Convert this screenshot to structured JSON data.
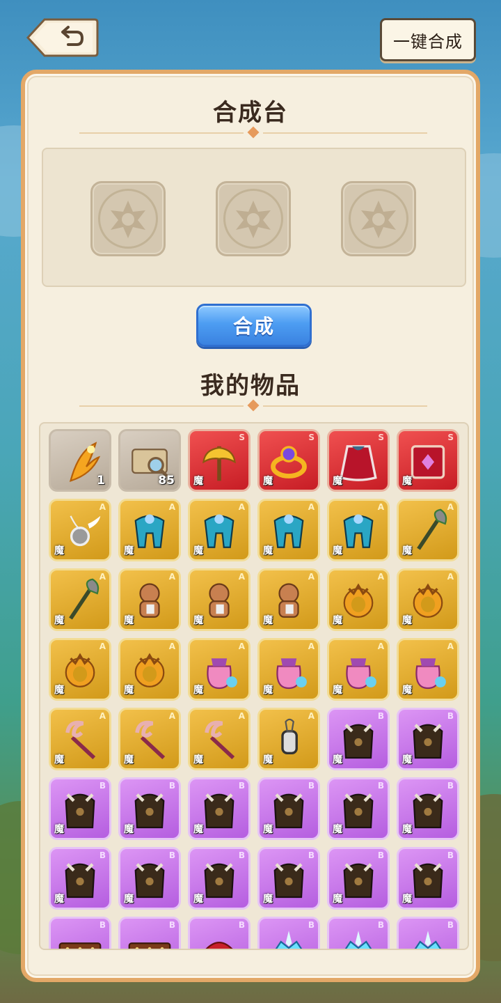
{
  "header": {
    "back_icon": "undo-arrow-icon",
    "one_click_label": "一键合成"
  },
  "synth_table": {
    "title": "合成台",
    "slots": [
      "empty",
      "empty",
      "empty"
    ],
    "slot_icon": "star-badge-icon",
    "button_label": "合成"
  },
  "inventory": {
    "title": "我的物品",
    "tag_label": "魔",
    "rarity_colors": {
      "S": "#d92a2f",
      "A": "#e0aa2a",
      "B": "#c47be8",
      "N": "#c9bcaa"
    },
    "items": [
      {
        "icon": "flame-feather-icon",
        "rarity": "N",
        "count": "1"
      },
      {
        "icon": "magnifier-scroll-icon",
        "rarity": "N",
        "count": "85"
      },
      {
        "icon": "golden-axe-icon",
        "rarity": "S",
        "tag": true
      },
      {
        "icon": "gem-ring-icon",
        "rarity": "S",
        "tag": true
      },
      {
        "icon": "red-cape-icon",
        "rarity": "S",
        "tag": true
      },
      {
        "icon": "red-spellbook-icon",
        "rarity": "S",
        "tag": true
      },
      {
        "icon": "winged-amulet-icon",
        "rarity": "A",
        "tag": true
      },
      {
        "icon": "blue-armor-icon",
        "rarity": "A",
        "tag": true
      },
      {
        "icon": "blue-armor-icon",
        "rarity": "A",
        "tag": true
      },
      {
        "icon": "blue-armor-icon",
        "rarity": "A",
        "tag": true
      },
      {
        "icon": "blue-armor-icon",
        "rarity": "A",
        "tag": true
      },
      {
        "icon": "green-axe-icon",
        "rarity": "A",
        "tag": true
      },
      {
        "icon": "green-axe-icon",
        "rarity": "A",
        "tag": true
      },
      {
        "icon": "voodoo-doll-icon",
        "rarity": "A",
        "tag": true
      },
      {
        "icon": "voodoo-doll-icon",
        "rarity": "A",
        "tag": true
      },
      {
        "icon": "voodoo-doll-icon",
        "rarity": "A",
        "tag": true
      },
      {
        "icon": "dragon-ring-icon",
        "rarity": "A",
        "tag": true
      },
      {
        "icon": "dragon-ring-icon",
        "rarity": "A",
        "tag": true
      },
      {
        "icon": "dragon-ring-icon",
        "rarity": "A",
        "tag": true
      },
      {
        "icon": "dragon-ring-icon",
        "rarity": "A",
        "tag": true
      },
      {
        "icon": "star-pouch-icon",
        "rarity": "A",
        "tag": true
      },
      {
        "icon": "star-pouch-icon",
        "rarity": "A",
        "tag": true
      },
      {
        "icon": "star-pouch-icon",
        "rarity": "A",
        "tag": true
      },
      {
        "icon": "star-pouch-icon",
        "rarity": "A",
        "tag": true
      },
      {
        "icon": "crescent-staff-icon",
        "rarity": "A",
        "tag": true
      },
      {
        "icon": "crescent-staff-icon",
        "rarity": "A",
        "tag": true
      },
      {
        "icon": "crescent-staff-icon",
        "rarity": "A",
        "tag": true
      },
      {
        "icon": "lantern-charm-icon",
        "rarity": "A",
        "tag": true
      },
      {
        "icon": "dark-armor-icon",
        "rarity": "B",
        "tag": true
      },
      {
        "icon": "dark-armor-icon",
        "rarity": "B",
        "tag": true
      },
      {
        "icon": "dark-armor-icon",
        "rarity": "B",
        "tag": true
      },
      {
        "icon": "dark-armor-icon",
        "rarity": "B",
        "tag": true
      },
      {
        "icon": "dark-armor-icon",
        "rarity": "B",
        "tag": true
      },
      {
        "icon": "dark-armor-icon",
        "rarity": "B",
        "tag": true
      },
      {
        "icon": "dark-armor-icon",
        "rarity": "B",
        "tag": true
      },
      {
        "icon": "dark-armor-icon",
        "rarity": "B",
        "tag": true
      },
      {
        "icon": "dark-armor-icon",
        "rarity": "B",
        "tag": true
      },
      {
        "icon": "dark-armor-icon",
        "rarity": "B",
        "tag": true
      },
      {
        "icon": "dark-armor-icon",
        "rarity": "B",
        "tag": true
      },
      {
        "icon": "dark-armor-icon",
        "rarity": "B",
        "tag": true
      },
      {
        "icon": "dark-armor-icon",
        "rarity": "B",
        "tag": true
      },
      {
        "icon": "dark-armor-icon",
        "rarity": "B",
        "tag": true
      },
      {
        "icon": "studded-belt-icon",
        "rarity": "B"
      },
      {
        "icon": "studded-belt-icon",
        "rarity": "B"
      },
      {
        "icon": "red-hat-icon",
        "rarity": "B"
      },
      {
        "icon": "crystal-crown-icon",
        "rarity": "B"
      },
      {
        "icon": "crystal-crown-icon",
        "rarity": "B"
      },
      {
        "icon": "crystal-crown-icon",
        "rarity": "B"
      }
    ]
  }
}
